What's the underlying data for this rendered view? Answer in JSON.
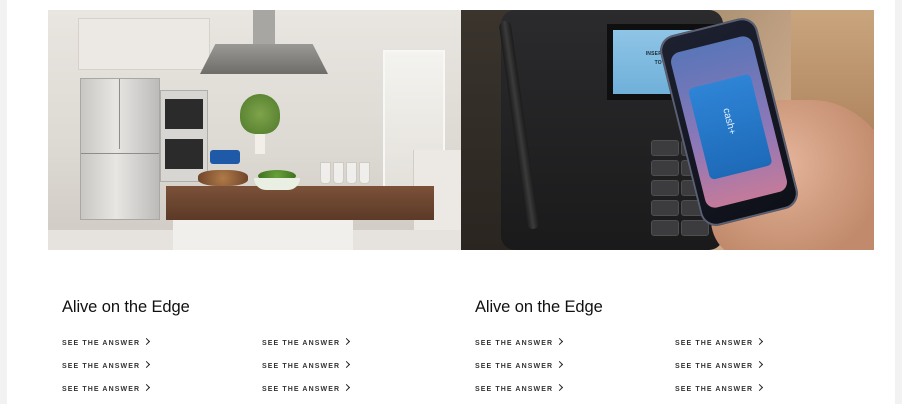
{
  "hero": {
    "left_image": "kitchen-with-island",
    "right_image": "mobile-payment-terminal",
    "terminal_screen_line1": "INSERT OR SWIPE CARD",
    "terminal_screen_line2": "TOTAL DUE: $6.38",
    "phone_card_label": "cash+"
  },
  "sections": [
    {
      "title": "Alive on the Edge",
      "links": [
        "SEE THE ANSWER",
        "SEE THE ANSWER",
        "SEE THE ANSWER",
        "SEE THE ANSWER",
        "SEE THE ANSWER",
        "SEE THE ANSWER"
      ]
    },
    {
      "title": "Alive on the Edge",
      "links": [
        "SEE THE ANSWER",
        "SEE THE ANSWER",
        "SEE THE ANSWER",
        "SEE THE ANSWER",
        "SEE THE ANSWER",
        "SEE THE ANSWER"
      ]
    }
  ],
  "icons": {
    "link_arrow": "chevron-right-icon"
  },
  "colors": {
    "page_bg": "#f2f2f2",
    "content_bg": "#ffffff",
    "text": "#111111"
  }
}
